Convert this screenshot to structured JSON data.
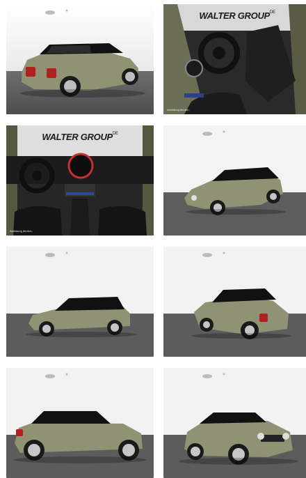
{
  "gallery": {
    "dealer_banner": {
      "text": "WALTER GROUP",
      "sub": "DE"
    },
    "interior_caption": "Abbildung ähnlich.",
    "images": [
      {
        "id": "rear-three-quarter"
      },
      {
        "id": "interior-driver-seat"
      },
      {
        "id": "interior-dashboard"
      },
      {
        "id": "front-three-quarter-high"
      },
      {
        "id": "side-profile-left"
      },
      {
        "id": "rear-three-quarter-right"
      },
      {
        "id": "side-profile-left-low"
      },
      {
        "id": "front-three-quarter-low"
      }
    ]
  },
  "colors": {
    "body": "#8f9273",
    "roof": "#111111",
    "studio_wall": "#f4f4f4",
    "studio_floor": "#5b5b5b",
    "interior": "#2a2a2a"
  }
}
